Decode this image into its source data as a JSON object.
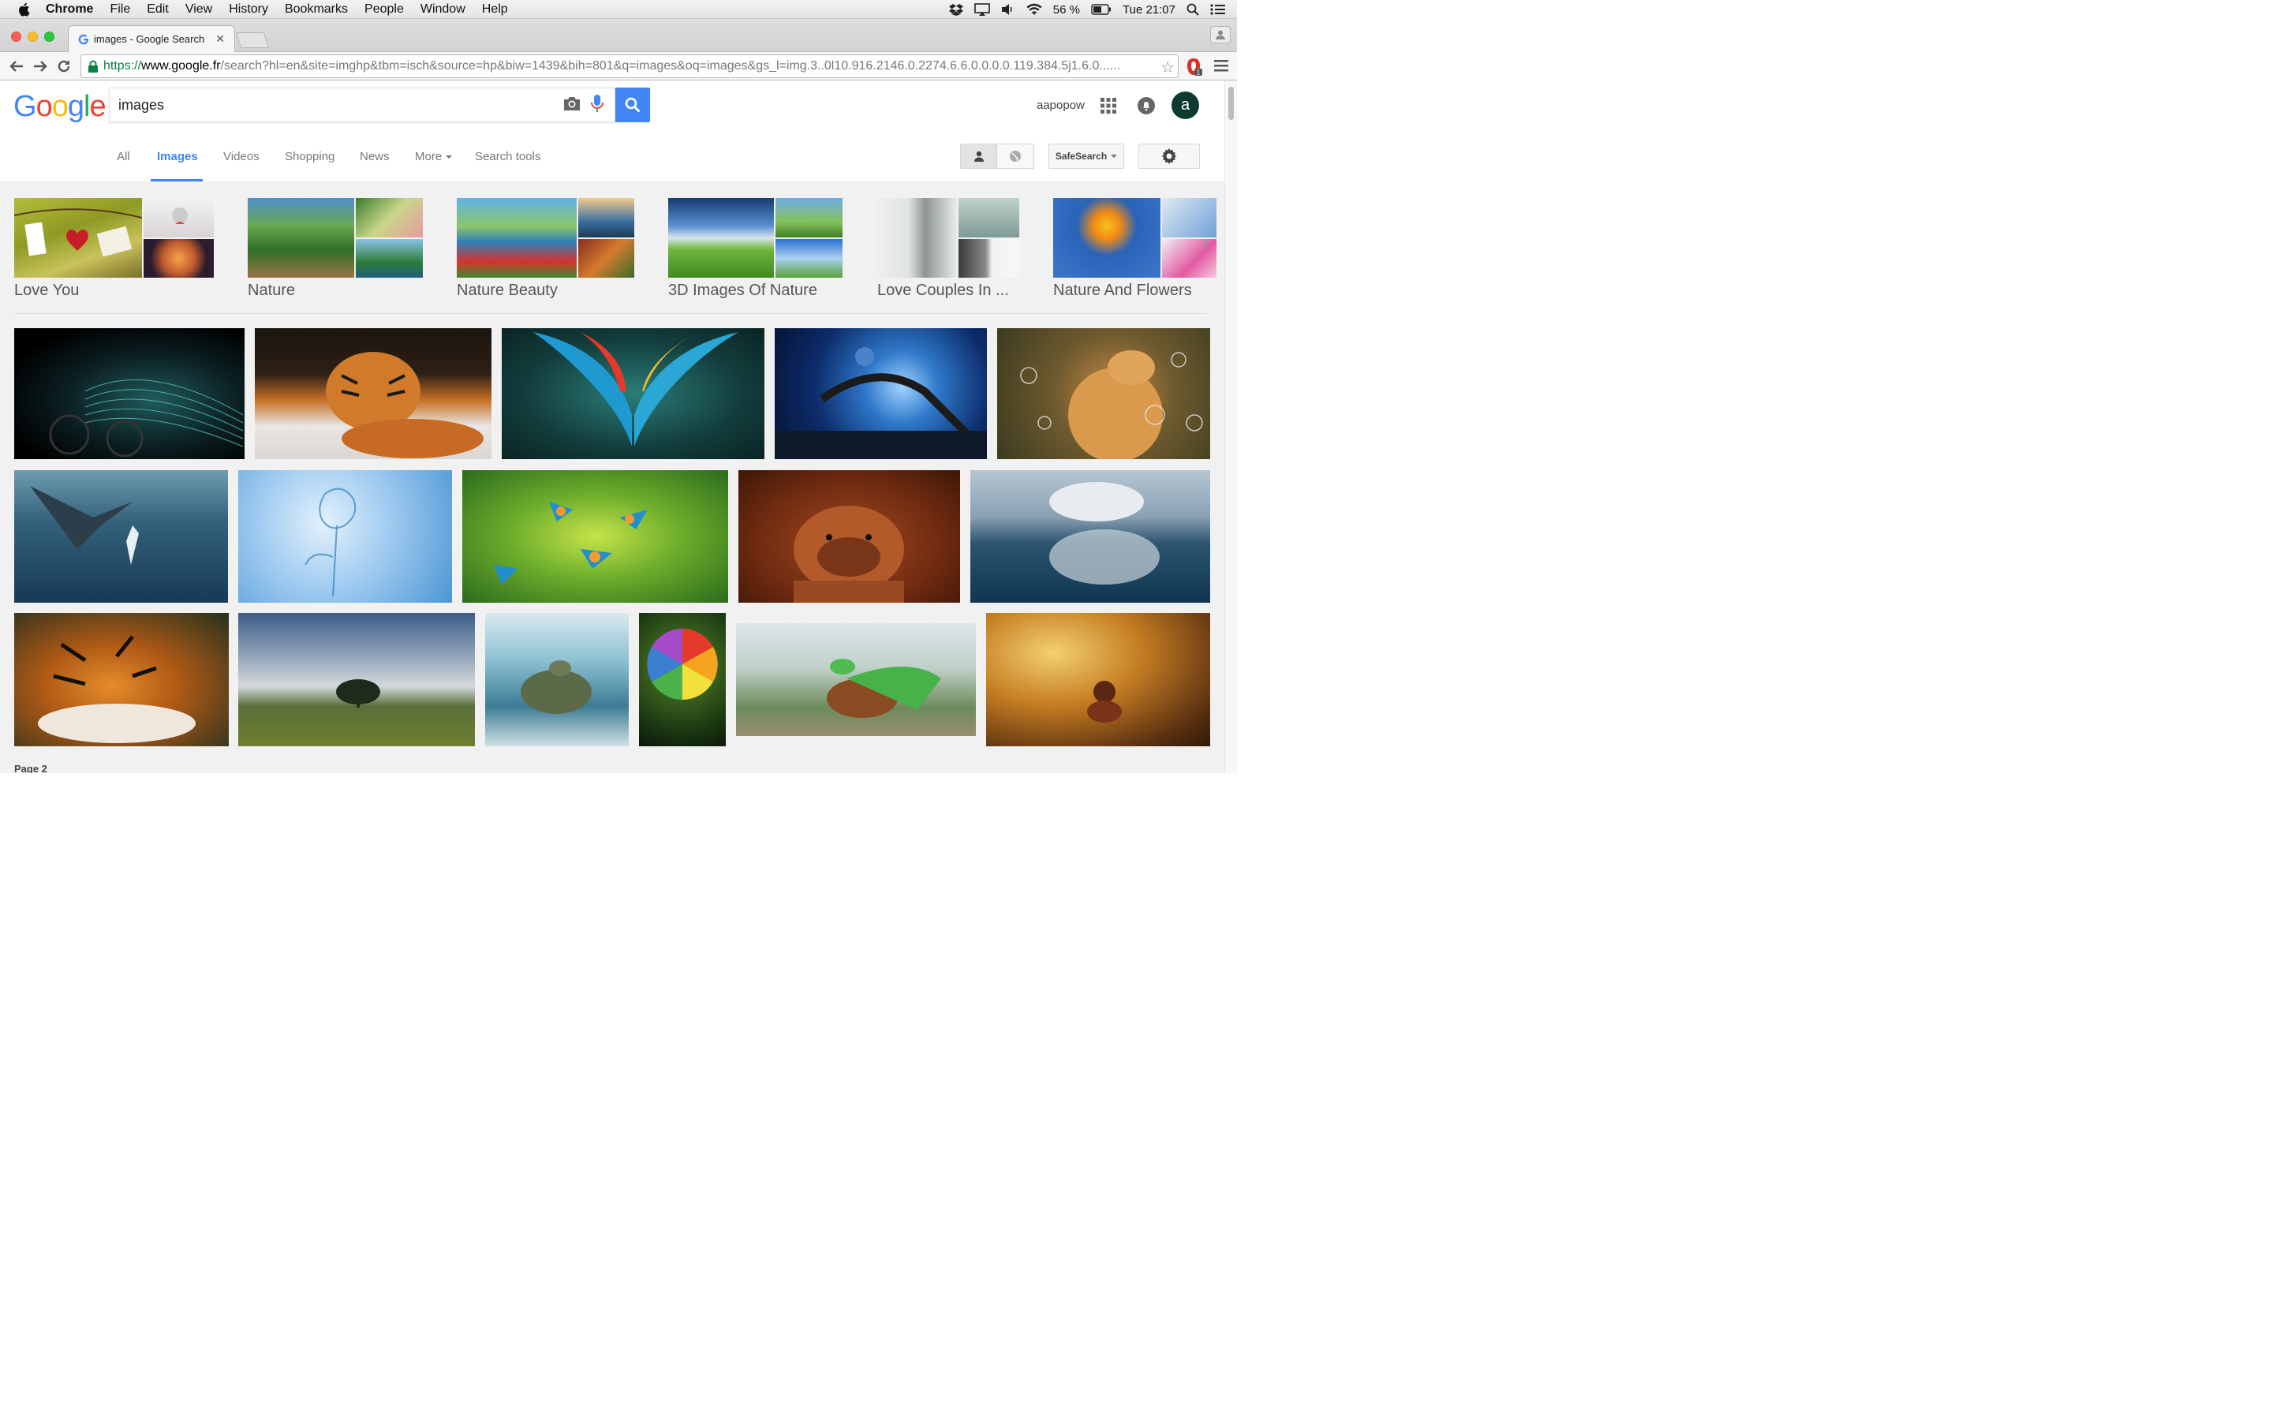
{
  "menubar": {
    "app": "Chrome",
    "items": [
      "File",
      "Edit",
      "View",
      "History",
      "Bookmarks",
      "People",
      "Window",
      "Help"
    ],
    "battery": "56 %",
    "clock": "Tue 21:07"
  },
  "browser": {
    "tab_title": "images - Google Search",
    "url_scheme": "https://",
    "url_host": "www.google.fr",
    "url_path": "/search?hl=en&site=imghp&tbm=isch&source=hp&biw=1439&bih=801&q=images&oq=images&gs_l=img.3..0l10.916.2146.0.2274.6.6.0.0.0.0.119.384.5j1.6.0......"
  },
  "google": {
    "query": "images",
    "username": "aapopow",
    "avatar_letter": "a",
    "tabs": [
      "All",
      "Images",
      "Videos",
      "Shopping",
      "News",
      "More",
      "Search tools"
    ],
    "safesearch": "SafeSearch"
  },
  "related": [
    {
      "label": "Love You"
    },
    {
      "label": "Nature"
    },
    {
      "label": "Nature Beauty"
    },
    {
      "label": "3D Images Of Nature"
    },
    {
      "label": "Love Couples In ..."
    },
    {
      "label": "Nature And Flowers"
    }
  ],
  "page_label": "Page 2",
  "colors": {
    "accent": "#4285f4",
    "url_green": "#0b8043"
  }
}
